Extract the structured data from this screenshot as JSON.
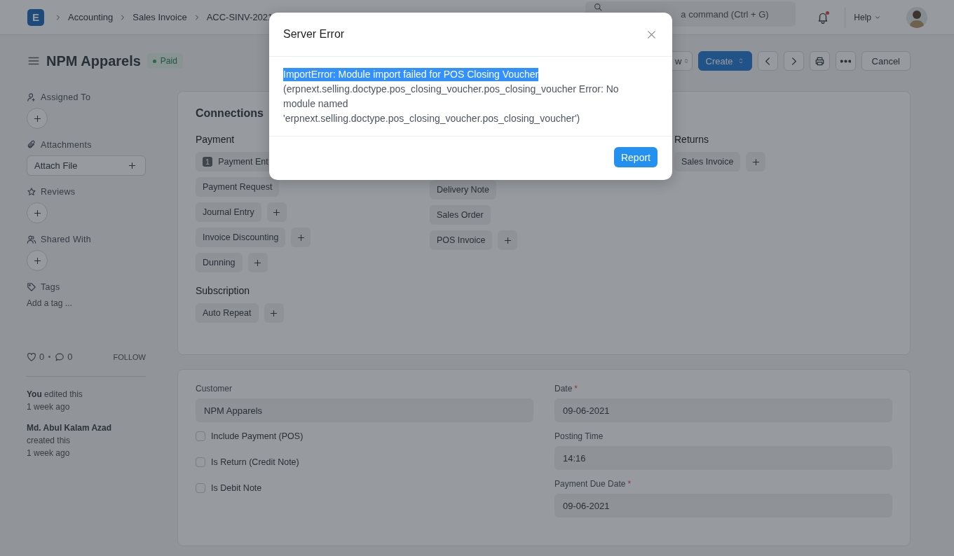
{
  "navbar": {
    "logo": "E",
    "breadcrumbs": [
      "Accounting",
      "Sales Invoice",
      "ACC-SINV-2021"
    ],
    "search": {
      "placeholder": "a command (Ctrl + G)"
    },
    "notifications_unread": true,
    "help": "Help"
  },
  "page_head": {
    "title": "NPM Apparels",
    "status": {
      "label": "Paid"
    },
    "actions": [
      {
        "kind": "select",
        "label": "w"
      },
      {
        "kind": "primary",
        "label": "Create"
      },
      {
        "kind": "prev"
      },
      {
        "kind": "next"
      },
      {
        "kind": "print"
      },
      {
        "kind": "more"
      },
      {
        "kind": "plain",
        "label": "Cancel"
      }
    ]
  },
  "sidebar": {
    "sections": [
      {
        "kind": "add",
        "title": "Assigned To"
      },
      {
        "kind": "attach",
        "title": "Attachments",
        "button": "Attach File"
      },
      {
        "kind": "add",
        "title": "Reviews"
      },
      {
        "kind": "add",
        "title": "Shared With"
      },
      {
        "kind": "tags",
        "title": "Tags",
        "placeholder": "Add a tag ..."
      }
    ],
    "likes": "0",
    "comments": "0",
    "follow": "FOLLOW",
    "activity": [
      {
        "text": "**You** edited this",
        "time": "1 week ago"
      },
      {
        "text": "**Md. Abul Kalam Azad** created this",
        "time": "1 week ago"
      }
    ]
  },
  "connections": {
    "title": "Connections",
    "columns": [
      {
        "groups": [
          {
            "title": "Payment",
            "items": [
              {
                "label": "Payment Ent",
                "count": "1"
              },
              {
                "label": "Payment Request",
                "add": false
              },
              {
                "label": "Journal Entry",
                "add": true
              },
              {
                "label": "Invoice Discounting",
                "add": true
              },
              {
                "label": "Dunning",
                "add": true
              }
            ]
          },
          {
            "title": "Subscription",
            "items": [
              {
                "label": "Auto Repeat",
                "add": true
              }
            ]
          }
        ]
      },
      {
        "groups": [
          {
            "items": [
              {
                "label": "Delivery Note",
                "add": false
              },
              {
                "label": "Sales Order",
                "add": false
              },
              {
                "label": "POS Invoice",
                "add": true
              }
            ]
          }
        ]
      },
      {
        "groups": [
          {
            "title": "Returns",
            "items": [
              {
                "label": "Sales Invoice",
                "add": true
              }
            ]
          }
        ]
      }
    ]
  },
  "form": {
    "left": [
      {
        "kind": "field",
        "label": "Customer",
        "value": "NPM Apparels"
      },
      {
        "kind": "check",
        "label": "Include Payment (POS)",
        "checked": false
      },
      {
        "kind": "check",
        "label": "Is Return (Credit Note)",
        "checked": false
      },
      {
        "kind": "check",
        "label": "Is Debit Note",
        "checked": false
      }
    ],
    "right": [
      {
        "kind": "field",
        "label": "Date",
        "required_mark": "*",
        "value": "09-06-2021"
      },
      {
        "kind": "field",
        "label": "Posting Time",
        "value": "14:16"
      },
      {
        "kind": "field",
        "label": "Payment Due Date",
        "required_mark": "*",
        "value": "09-06-2021"
      }
    ]
  },
  "dialog": {
    "title": "Server Error",
    "headline": "ImportError: Module import failed for POS Closing Voucher",
    "headline_highlighted": true,
    "detail": "(erpnext.selling.doctype.pos_closing_voucher.pos_closing_voucher Error: No module named 'erpnext.selling.doctype.pos_closing_voucher.pos_closing_voucher')",
    "button": "Report"
  }
}
